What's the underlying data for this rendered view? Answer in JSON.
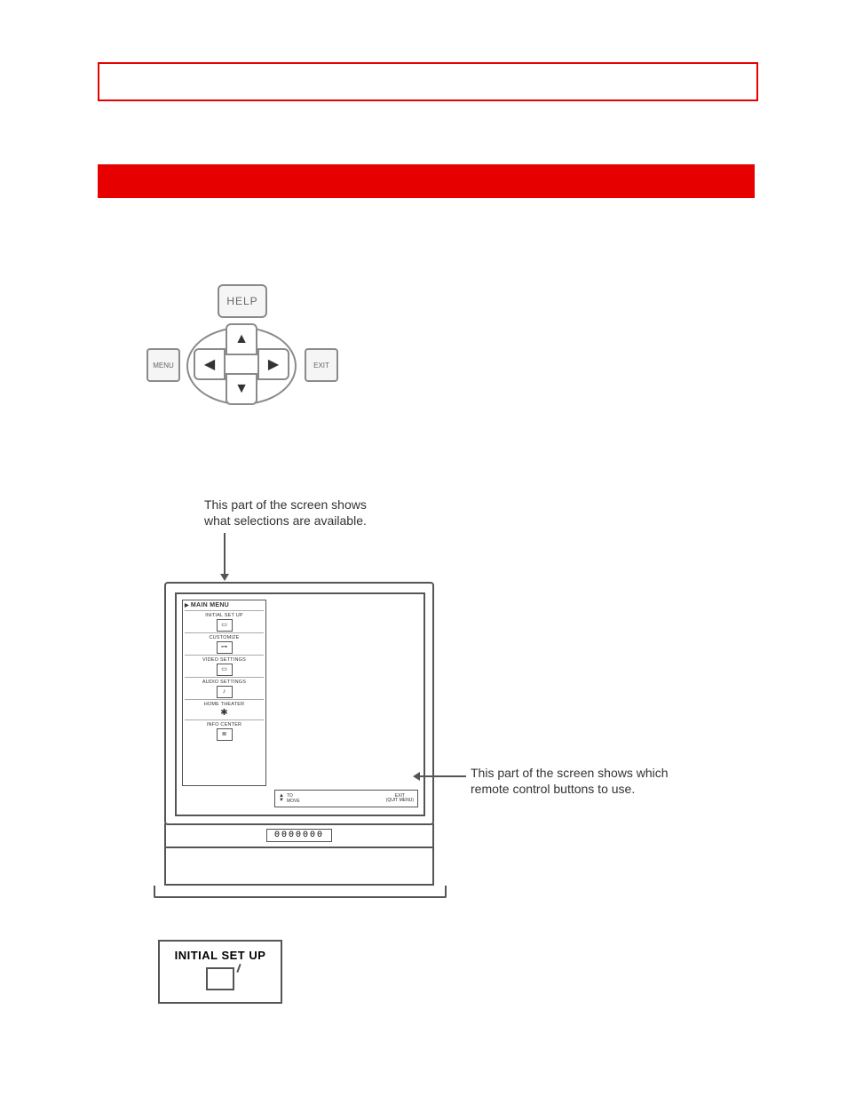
{
  "remote": {
    "help_label": "HELP",
    "menu_label": "MENU",
    "exit_label": "EXIT",
    "arrows": {
      "up": "▲",
      "down": "▼",
      "left": "◀",
      "right": "▶"
    }
  },
  "diagram": {
    "callout_top_line1": "This part of the screen shows",
    "callout_top_line2": "what selections are available.",
    "callout_right_line1": "This part of the screen shows which",
    "callout_right_line2": "remote control buttons to use.",
    "counter": "0000000"
  },
  "menu": {
    "title": "MAIN MENU",
    "items": [
      {
        "label": "INITIAL SET UP",
        "icon": "tv-icon"
      },
      {
        "label": "CUSTOMIZE",
        "icon": "slider-icon"
      },
      {
        "label": "VIDEO SETTINGS",
        "icon": "video-icon"
      },
      {
        "label": "AUDIO SETTINGS",
        "icon": "note-icon"
      },
      {
        "label": "HOME THEATER",
        "icon": "theater-icon"
      },
      {
        "label": "INFO CENTER",
        "icon": "list-icon"
      }
    ]
  },
  "hint_bar": {
    "move_label_line1": "TO",
    "move_label_line2": "MOVE",
    "exit_label_line1": "EXIT",
    "exit_label_line2": "(QUIT MENU)"
  },
  "isu": {
    "label": "INITIAL SET UP"
  }
}
